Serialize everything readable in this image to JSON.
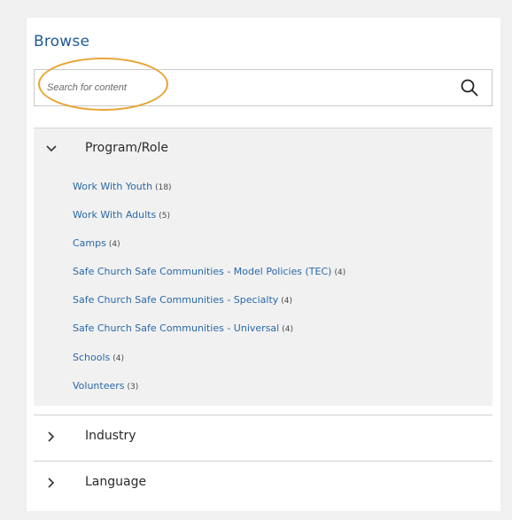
{
  "browse": {
    "title": "Browse"
  },
  "search": {
    "placeholder": "Search for content",
    "value": ""
  },
  "facets": [
    {
      "title": "Program/Role",
      "expanded": true,
      "items": [
        {
          "label": "Work With Youth",
          "count": "(18)"
        },
        {
          "label": "Work With Adults",
          "count": "(5)"
        },
        {
          "label": "Camps",
          "count": "(4)"
        },
        {
          "label": "Safe Church Safe Communities - Model Policies (TEC)",
          "count": "(4)"
        },
        {
          "label": "Safe Church Safe Communities - Specialty",
          "count": "(4)"
        },
        {
          "label": "Safe Church Safe Communities - Universal",
          "count": "(4)"
        },
        {
          "label": "Schools",
          "count": "(4)"
        },
        {
          "label": "Volunteers",
          "count": "(3)"
        }
      ]
    },
    {
      "title": "Industry",
      "expanded": false,
      "items": []
    },
    {
      "title": "Language",
      "expanded": false,
      "items": []
    }
  ],
  "colors": {
    "accent": "#1f5c99",
    "link": "#2a69a8",
    "highlight": "#e7a534",
    "expanded_bg": "#f1f1f1"
  },
  "icons": {
    "search": "search-icon",
    "expanded": "chevron-down-icon",
    "collapsed": "chevron-right-icon"
  }
}
